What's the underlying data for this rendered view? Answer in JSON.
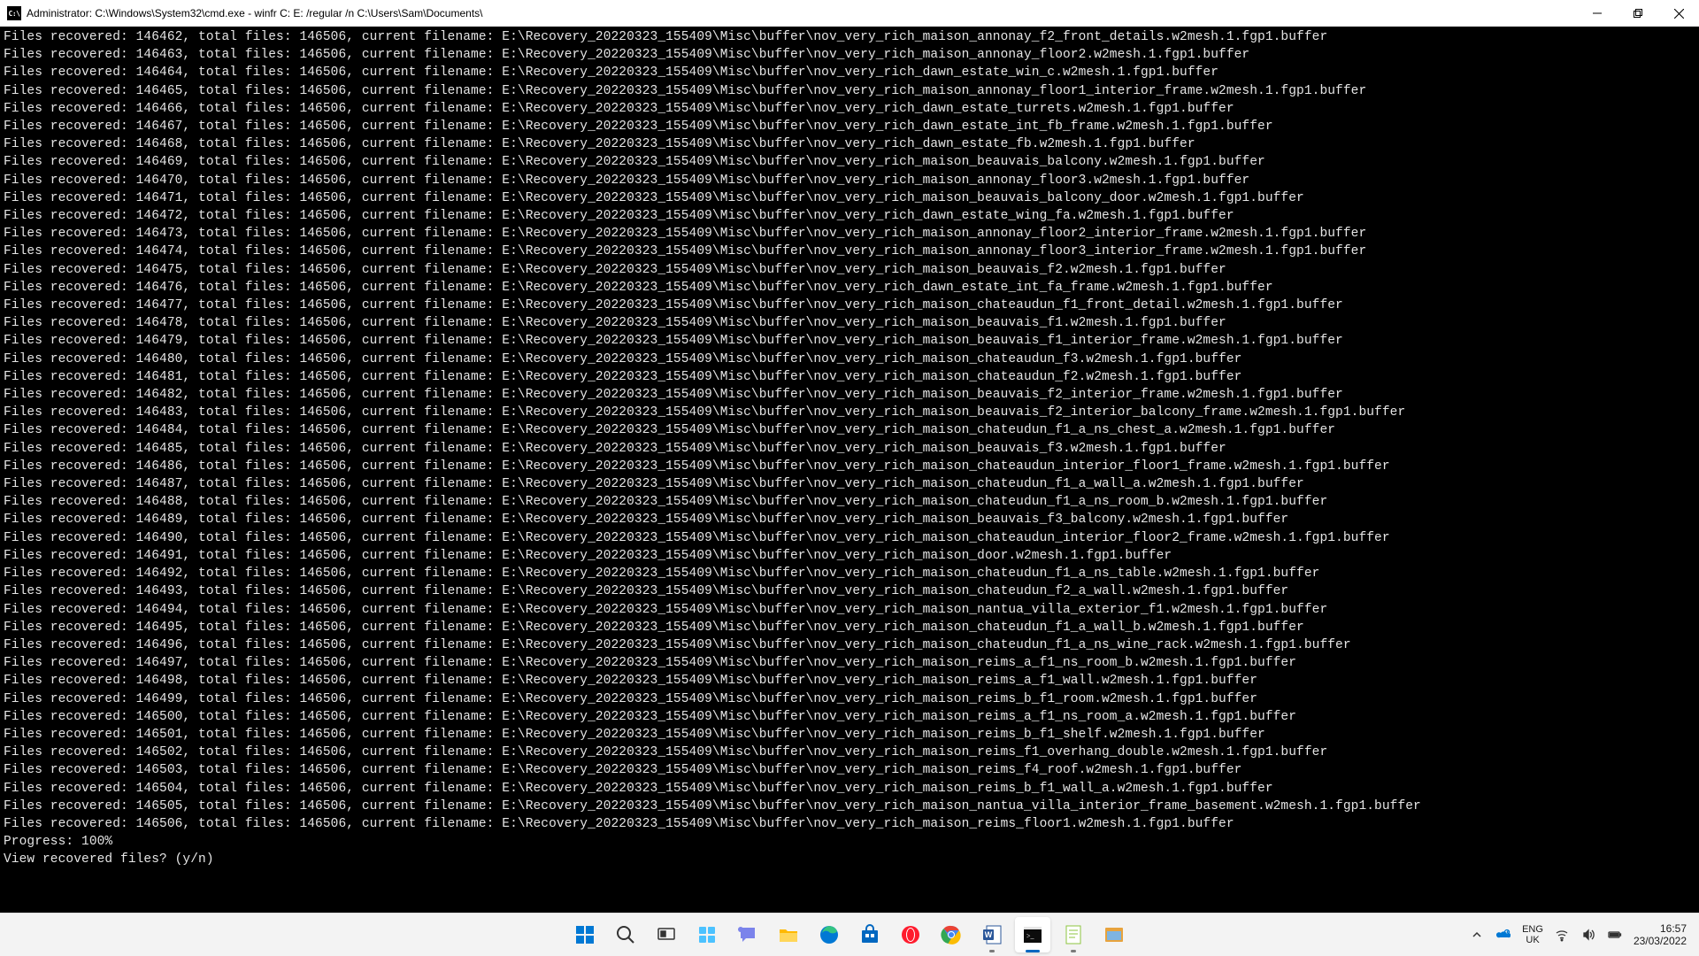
{
  "window": {
    "app_icon_text": "C:\\",
    "title": "Administrator: C:\\Windows\\System32\\cmd.exe - winfr  C: E: /regular /n C:\\Users\\Sam\\Documents\\"
  },
  "common": {
    "prefix_label": "Files recovered: ",
    "total_label": ", total files: ",
    "total_files": "146506",
    "filename_label": ", current filename: ",
    "base_path": "E:\\Recovery_20220323_155409\\Misc\\buffer\\",
    "suffix": ".w2mesh.1.fgp1.buffer"
  },
  "rows": [
    {
      "n": "146462",
      "f": "nov_very_rich_maison_annonay_f2_front_details"
    },
    {
      "n": "146463",
      "f": "nov_very_rich_maison_annonay_floor2"
    },
    {
      "n": "146464",
      "f": "nov_very_rich_dawn_estate_win_c"
    },
    {
      "n": "146465",
      "f": "nov_very_rich_maison_annonay_floor1_interior_frame"
    },
    {
      "n": "146466",
      "f": "nov_very_rich_dawn_estate_turrets"
    },
    {
      "n": "146467",
      "f": "nov_very_rich_dawn_estate_int_fb_frame"
    },
    {
      "n": "146468",
      "f": "nov_very_rich_dawn_estate_fb"
    },
    {
      "n": "146469",
      "f": "nov_very_rich_maison_beauvais_balcony"
    },
    {
      "n": "146470",
      "f": "nov_very_rich_maison_annonay_floor3"
    },
    {
      "n": "146471",
      "f": "nov_very_rich_maison_beauvais_balcony_door"
    },
    {
      "n": "146472",
      "f": "nov_very_rich_dawn_estate_wing_fa"
    },
    {
      "n": "146473",
      "f": "nov_very_rich_maison_annonay_floor2_interior_frame"
    },
    {
      "n": "146474",
      "f": "nov_very_rich_maison_annonay_floor3_interior_frame"
    },
    {
      "n": "146475",
      "f": "nov_very_rich_maison_beauvais_f2"
    },
    {
      "n": "146476",
      "f": "nov_very_rich_dawn_estate_int_fa_frame"
    },
    {
      "n": "146477",
      "f": "nov_very_rich_maison_chateaudun_f1_front_detail"
    },
    {
      "n": "146478",
      "f": "nov_very_rich_maison_beauvais_f1"
    },
    {
      "n": "146479",
      "f": "nov_very_rich_maison_beauvais_f1_interior_frame"
    },
    {
      "n": "146480",
      "f": "nov_very_rich_maison_chateaudun_f3"
    },
    {
      "n": "146481",
      "f": "nov_very_rich_maison_chateaudun_f2"
    },
    {
      "n": "146482",
      "f": "nov_very_rich_maison_beauvais_f2_interior_frame"
    },
    {
      "n": "146483",
      "f": "nov_very_rich_maison_beauvais_f2_interior_balcony_frame"
    },
    {
      "n": "146484",
      "f": "nov_very_rich_maison_chateudun_f1_a_ns_chest_a"
    },
    {
      "n": "146485",
      "f": "nov_very_rich_maison_beauvais_f3"
    },
    {
      "n": "146486",
      "f": "nov_very_rich_maison_chateaudun_interior_floor1_frame"
    },
    {
      "n": "146487",
      "f": "nov_very_rich_maison_chateudun_f1_a_wall_a"
    },
    {
      "n": "146488",
      "f": "nov_very_rich_maison_chateudun_f1_a_ns_room_b"
    },
    {
      "n": "146489",
      "f": "nov_very_rich_maison_beauvais_f3_balcony"
    },
    {
      "n": "146490",
      "f": "nov_very_rich_maison_chateaudun_interior_floor2_frame"
    },
    {
      "n": "146491",
      "f": "nov_very_rich_maison_door"
    },
    {
      "n": "146492",
      "f": "nov_very_rich_maison_chateudun_f1_a_ns_table"
    },
    {
      "n": "146493",
      "f": "nov_very_rich_maison_chateudun_f2_a_wall"
    },
    {
      "n": "146494",
      "f": "nov_very_rich_maison_nantua_villa_exterior_f1"
    },
    {
      "n": "146495",
      "f": "nov_very_rich_maison_chateudun_f1_a_wall_b"
    },
    {
      "n": "146496",
      "f": "nov_very_rich_maison_chateudun_f1_a_ns_wine_rack"
    },
    {
      "n": "146497",
      "f": "nov_very_rich_maison_reims_a_f1_ns_room_b"
    },
    {
      "n": "146498",
      "f": "nov_very_rich_maison_reims_a_f1_wall"
    },
    {
      "n": "146499",
      "f": "nov_very_rich_maison_reims_b_f1_room"
    },
    {
      "n": "146500",
      "f": "nov_very_rich_maison_reims_a_f1_ns_room_a"
    },
    {
      "n": "146501",
      "f": "nov_very_rich_maison_reims_b_f1_shelf"
    },
    {
      "n": "146502",
      "f": "nov_very_rich_maison_reims_f1_overhang_double"
    },
    {
      "n": "146503",
      "f": "nov_very_rich_maison_reims_f4_roof"
    },
    {
      "n": "146504",
      "f": "nov_very_rich_maison_reims_b_f1_wall_a"
    },
    {
      "n": "146505",
      "f": "nov_very_rich_maison_nantua_villa_interior_frame_basement"
    },
    {
      "n": "146506",
      "f": "nov_very_rich_maison_reims_floor1"
    }
  ],
  "progress_line": "Progress: 100%",
  "prompt_line": "View recovered files? (y/n)",
  "taskbar": {
    "lang_top": "ENG",
    "lang_bottom": "UK",
    "time": "16:57",
    "date": "23/03/2022"
  }
}
